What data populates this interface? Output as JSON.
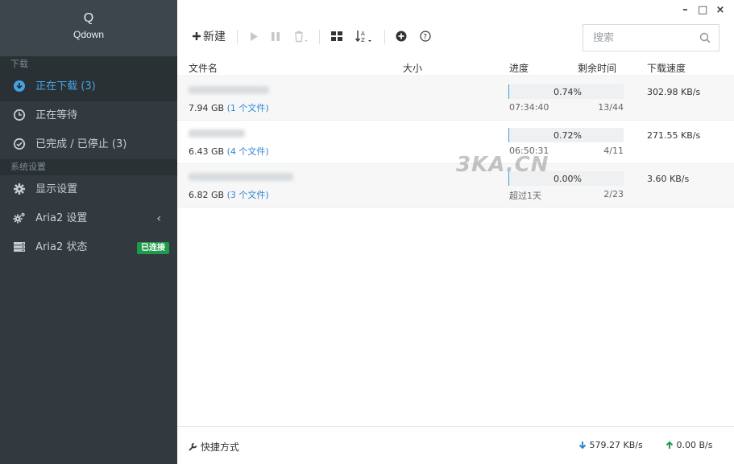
{
  "brand": {
    "logo": "Q",
    "name": "Qdown"
  },
  "sidebar": {
    "section_download": "下载",
    "items_download": [
      {
        "label": "正在下载 (3)",
        "icon": "download-icon",
        "active": true
      },
      {
        "label": "正在等待",
        "icon": "clock-icon",
        "active": false
      },
      {
        "label": "已完成 / 已停止 (3)",
        "icon": "check-circle-icon",
        "active": false
      }
    ],
    "section_settings": "系统设置",
    "items_settings": [
      {
        "label": "显示设置",
        "icon": "gear-icon"
      },
      {
        "label": "Aria2 设置",
        "icon": "gears-icon",
        "chevron": "‹"
      },
      {
        "label": "Aria2 状态",
        "icon": "server-icon",
        "badge": "已连接"
      }
    ]
  },
  "window": {
    "minimize": "–",
    "maximize": "□",
    "close": "×"
  },
  "toolbar": {
    "new_label": "新建"
  },
  "search": {
    "placeholder": "搜索"
  },
  "columns": {
    "name": "文件名",
    "size": "大小",
    "progress": "进度",
    "remaining": "剩余时间",
    "speed": "下载速度"
  },
  "tasks": [
    {
      "size": "7.94 GB",
      "files": "(1 个文件)",
      "progress": 0.74,
      "progress_text": "0.74%",
      "remaining": "07:34:40",
      "connections": "13/44",
      "speed": "302.98 KB/s"
    },
    {
      "size": "6.43 GB",
      "files": "(4 个文件)",
      "progress": 0.72,
      "progress_text": "0.72%",
      "remaining": "06:50:31",
      "connections": "4/11",
      "speed": "271.55 KB/s"
    },
    {
      "size": "6.82 GB",
      "files": "(3 个文件)",
      "progress": 0.0,
      "progress_text": "0.00%",
      "remaining": "超过1天",
      "connections": "2/23",
      "speed": "3.60 KB/s"
    }
  ],
  "watermark": "3KA.CN",
  "footer": {
    "shortcut_label": "快捷方式",
    "download_speed": "579.27 KB/s",
    "upload_speed": "0.00 B/s"
  },
  "colors": {
    "accent": "#45a3e5",
    "sidebar_bg": "#323a3f",
    "badge": "#1e9b4a",
    "progress": "#3fa0d8",
    "download_arrow": "#2f86d0",
    "upload_arrow": "#1e9b4a"
  }
}
